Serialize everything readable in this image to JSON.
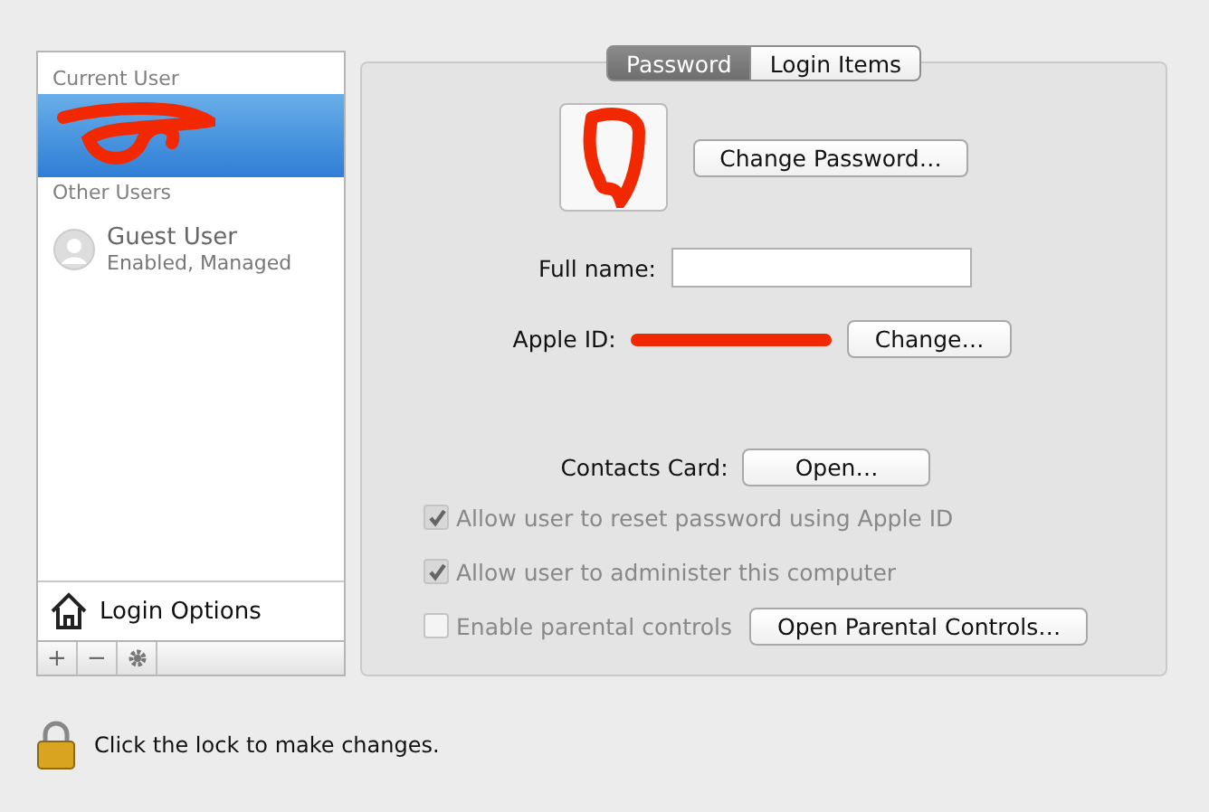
{
  "sidebar": {
    "sections": [
      {
        "heading": "Current User",
        "users": [
          {
            "kind": "redacted",
            "selected": true
          }
        ]
      },
      {
        "heading": "Other Users",
        "users": [
          {
            "kind": "guest",
            "name": "Guest User",
            "status": "Enabled, Managed",
            "selected": false
          }
        ]
      }
    ],
    "login_options": "Login Options",
    "toolbar": [
      "+",
      "−"
    ]
  },
  "tabs": [
    {
      "label": "Password",
      "selected": true
    },
    {
      "label": "Login Items",
      "selected": false
    }
  ],
  "change_password_button": "Change Password…",
  "full_name": {
    "label": "Full name:"
  },
  "apple_id": {
    "label": "Apple ID:",
    "button": "Change…"
  },
  "contacts_card": {
    "label": "Contacts Card:",
    "button": "Open…"
  },
  "options": [
    {
      "label": "Allow user to reset password using Apple ID",
      "checked": true,
      "disabled": true
    },
    {
      "label": "Allow user to administer this computer",
      "checked": true,
      "disabled": true
    },
    {
      "label": "Enable parental controls",
      "checked": false,
      "disabled": true,
      "button": "Open Parental Controls…"
    }
  ],
  "lock_text": "Click the lock to make changes."
}
